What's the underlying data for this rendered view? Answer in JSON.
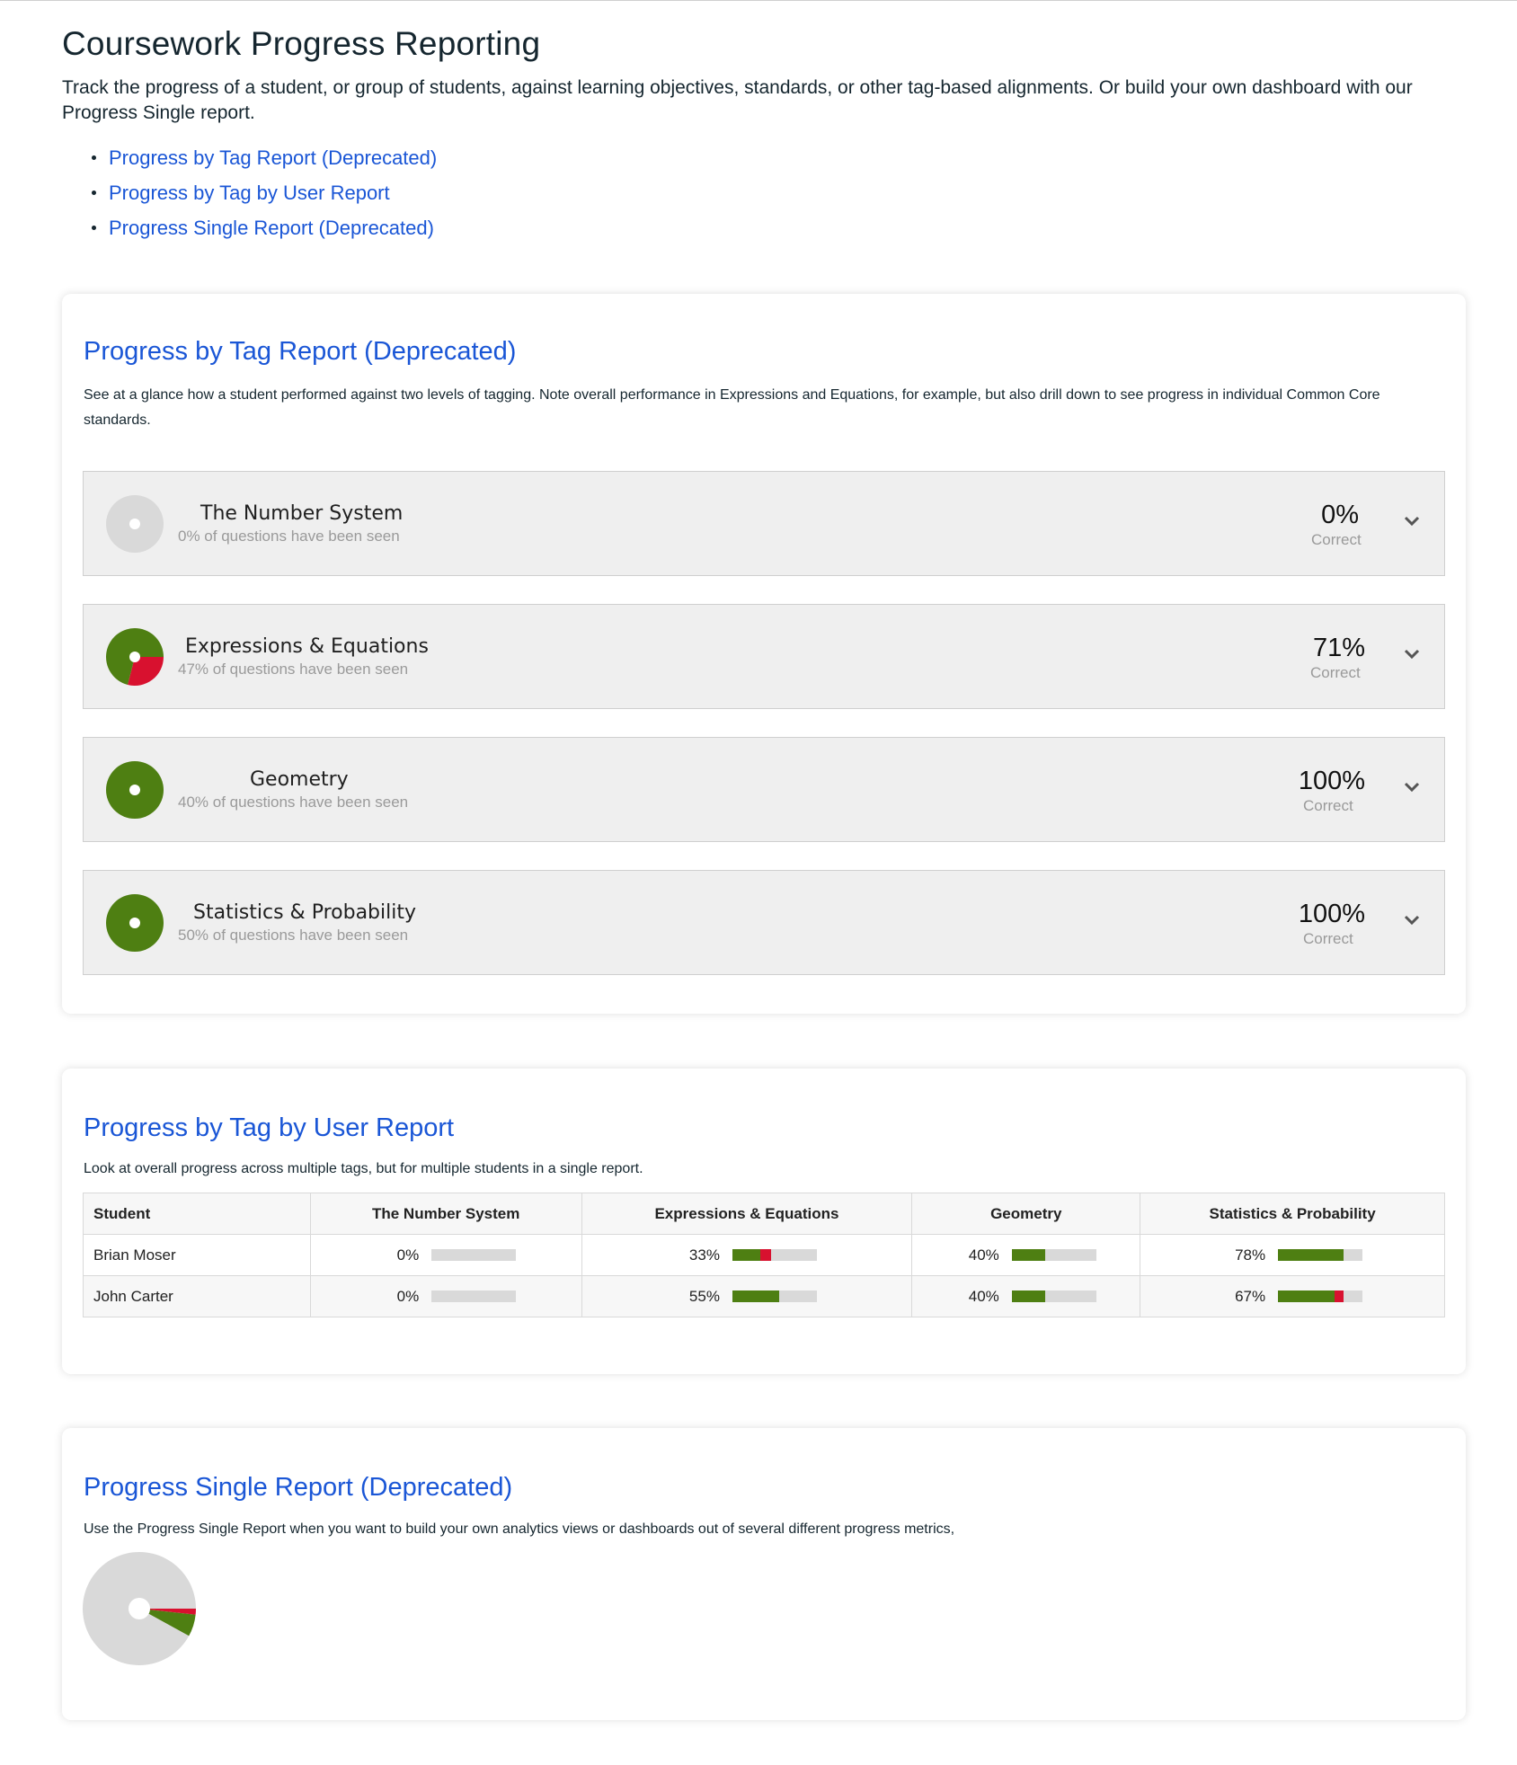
{
  "colors": {
    "link": "#1a56d6",
    "correct": "#4e7f12",
    "incorrect": "#d8112f",
    "unseen": "#d9d9d9",
    "row_bg": "#efefef"
  },
  "page": {
    "title": "Coursework Progress Reporting",
    "intro": "Track the progress of a student, or group of students, against learning objectives, standards, or other tag-based alignments. Or build your own dashboard with our Progress Single report.",
    "links": [
      "Progress by Tag Report (Deprecated)",
      "Progress by Tag by User Report",
      "Progress Single Report (Deprecated)"
    ]
  },
  "tag_report": {
    "title": "Progress by Tag Report (Deprecated)",
    "description": "See at a glance how a student performed against two levels of tagging. Note overall performance in Expressions and Equations, for example, but also drill down to see progress in individual Common Core standards.",
    "correct_label": "Correct",
    "tags": [
      {
        "name": "The Number System",
        "seen": "0% of questions have been seen",
        "percent": "0%",
        "correct_fraction": 0,
        "incorrect_fraction": 0
      },
      {
        "name": "Expressions & Equations",
        "seen": "47% of questions have been seen",
        "percent": "71%",
        "correct_fraction": 0.71,
        "incorrect_fraction": 0.29
      },
      {
        "name": "Geometry",
        "seen": "40% of questions have been seen",
        "percent": "100%",
        "correct_fraction": 1,
        "incorrect_fraction": 0
      },
      {
        "name": "Statistics & Probability",
        "seen": "50% of questions have been seen",
        "percent": "100%",
        "correct_fraction": 1,
        "incorrect_fraction": 0
      }
    ]
  },
  "user_report": {
    "title": "Progress by Tag by User Report",
    "description": "Look at overall progress across multiple tags, but for multiple students in a single report.",
    "columns": [
      "Student",
      "The Number System",
      "Expressions & Equations",
      "Geometry",
      "Statistics & Probability"
    ],
    "rows": [
      {
        "student": "Brian Moser",
        "cells": [
          {
            "value": "0%",
            "correct": 0,
            "incorrect": 0
          },
          {
            "value": "33%",
            "correct": 0.33,
            "incorrect": 0.13
          },
          {
            "value": "40%",
            "correct": 0.4,
            "incorrect": 0
          },
          {
            "value": "78%",
            "correct": 0.78,
            "incorrect": 0
          }
        ]
      },
      {
        "student": "John Carter",
        "cells": [
          {
            "value": "0%",
            "correct": 0,
            "incorrect": 0
          },
          {
            "value": "55%",
            "correct": 0.55,
            "incorrect": 0
          },
          {
            "value": "40%",
            "correct": 0.4,
            "incorrect": 0
          },
          {
            "value": "67%",
            "correct": 0.67,
            "incorrect": 0.11
          }
        ]
      }
    ]
  },
  "single_report": {
    "title": "Progress Single Report (Deprecated)",
    "description": "Use the Progress Single Report when you want to build your own analytics views or dashboards out of several different progress metrics,",
    "pie": {
      "correct_fraction": 0.063,
      "incorrect_fraction": 0.017,
      "unseen_fraction": 0.92
    }
  }
}
